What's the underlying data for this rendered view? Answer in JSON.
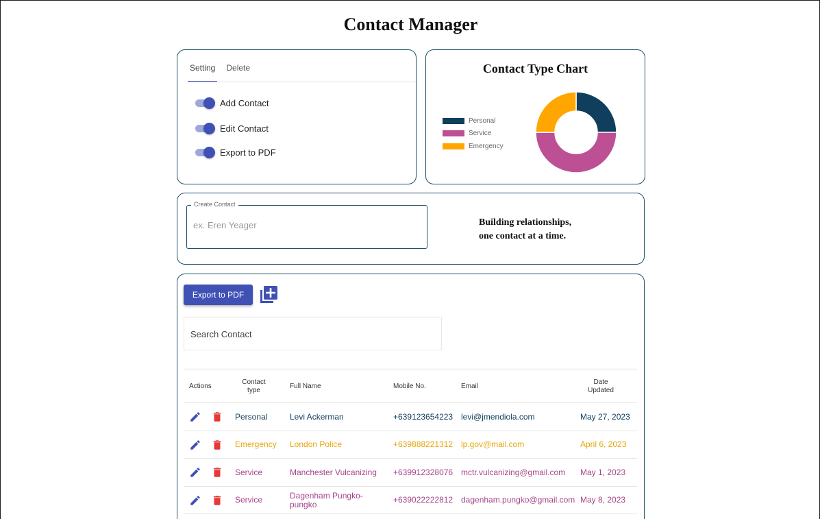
{
  "app": {
    "title": "Contact Manager"
  },
  "settings": {
    "tabs": [
      {
        "label": "Setting"
      },
      {
        "label": "Delete"
      }
    ],
    "toggles": [
      {
        "label": "Add Contact",
        "on": true
      },
      {
        "label": "Edit Contact",
        "on": true
      },
      {
        "label": "Export to PDF",
        "on": true
      }
    ]
  },
  "chart": {
    "title": "Contact Type Chart",
    "legend": [
      {
        "label": "Personal",
        "color": "#0f3f5c"
      },
      {
        "label": "Service",
        "color": "#bd5094"
      },
      {
        "label": "Emergency",
        "color": "#ffa600"
      }
    ]
  },
  "chart_data": {
    "type": "pie",
    "title": "Contact Type Chart",
    "donut": true,
    "categories": [
      "Personal",
      "Service",
      "Emergency"
    ],
    "values": [
      1,
      2,
      1
    ],
    "colors": [
      "#0f3f5c",
      "#bd5094",
      "#ffa600"
    ],
    "legend_position": "left"
  },
  "create": {
    "label": "Create Contact",
    "placeholder": "ex. Eren Yeager",
    "value": "",
    "tagline_line1": "Building relationships,",
    "tagline_line2": "one contact at a time."
  },
  "toolbar": {
    "export_label": "Export to PDF",
    "add_icon": "library-add-icon",
    "search_placeholder": "Search Contact"
  },
  "table": {
    "headers": {
      "actions": "Actions",
      "type_line1": "Contact",
      "type_line2": "type",
      "name": "Full Name",
      "mobile": "Mobile No.",
      "email": "Email",
      "date_line1": "Date",
      "date_line2": "Updated"
    },
    "rows": [
      {
        "type": "Personal",
        "name": "Levi Ackerman",
        "mobile": "+639123654223",
        "email": "levi@jmendiola.com",
        "date": "May 27, 2023",
        "color": "#0f3f5c"
      },
      {
        "type": "Emergency",
        "name": "London Police",
        "mobile": "+639888221312",
        "email": "lp.gov@mail.com",
        "date": "April 6, 2023",
        "color": "#e8a50c"
      },
      {
        "type": "Service",
        "name": "Manchester Vulcanizing",
        "mobile": "+639912328076",
        "email": "mctr.vulcanizing@gmail.com",
        "date": "May 1, 2023",
        "color": "#a8458a"
      },
      {
        "type": "Service",
        "name": "Dagenham Pungko-pungko",
        "mobile": "+639022222812",
        "email": "dagenham.pungko@gmail.com",
        "date": "May 8, 2023",
        "color": "#a8458a"
      }
    ],
    "edit_icon": "pencil-icon",
    "delete_icon": "trash-icon",
    "edit_color": "#3f51b5",
    "delete_color": "#e53935"
  }
}
